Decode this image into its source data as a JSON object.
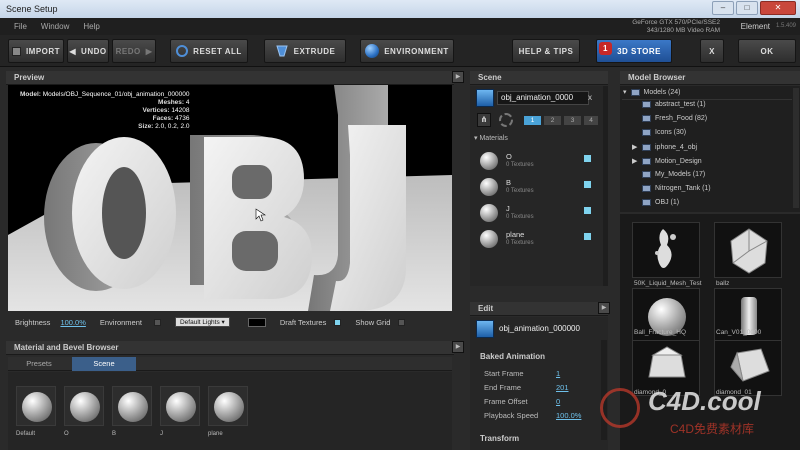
{
  "window": {
    "title": "Scene Setup",
    "minimize": "–",
    "maximize": "□",
    "close": "✕"
  },
  "menu": [
    "File",
    "Window",
    "Help"
  ],
  "sysinfo": {
    "gpu": "GeForce GTX 570/PCIe/SSE2",
    "vram": "343/1280 MB Video RAM",
    "app": "Element",
    "version": "1.5.409"
  },
  "toolbar": {
    "import": "IMPORT",
    "undo": "UNDO",
    "redo": "REDO",
    "reset": "RESET ALL",
    "extrude": "EXTRUDE",
    "environment": "ENVIRONMENT",
    "help": "HELP & TIPS",
    "store": "3D STORE",
    "store_badge": "1",
    "close": "X",
    "ok": "OK"
  },
  "preview": {
    "title": "Preview",
    "info": [
      {
        "label": "Model:",
        "value": "Models/OBJ_Sequence_01/obj_animation_000000"
      },
      {
        "label": "Meshes:",
        "value": "4"
      },
      {
        "label": "Vertices:",
        "value": "14208"
      },
      {
        "label": "Faces:",
        "value": "4736"
      },
      {
        "label": "Size:",
        "value": "2.0, 0.2, 2.0"
      }
    ],
    "brightness_label": "Brightness",
    "brightness_value": "100.0%",
    "environment_label": "Environment",
    "lights_value": "Default Lights",
    "draft_label": "Draft Textures",
    "grid_label": "Show Grid"
  },
  "scene": {
    "title": "Scene",
    "object_name": "obj_animation_0000",
    "close": "x",
    "tabs": [
      "1",
      "2",
      "3",
      "4"
    ],
    "materials_header": "Materials",
    "materials": [
      {
        "name": "O",
        "sub": "0 Textures"
      },
      {
        "name": "B",
        "sub": "0 Textures"
      },
      {
        "name": "J",
        "sub": "0 Textures"
      },
      {
        "name": "plane",
        "sub": "0 Textures"
      }
    ]
  },
  "edit": {
    "title": "Edit",
    "object_name": "obj_animation_000000",
    "section": "Baked Animation",
    "rows": [
      {
        "label": "Start Frame",
        "value": "1"
      },
      {
        "label": "End Frame",
        "value": "201"
      },
      {
        "label": "Frame Offset",
        "value": "0"
      },
      {
        "label": "Playback Speed",
        "value": "100.0%"
      }
    ],
    "section2": "Transform"
  },
  "model_browser": {
    "title": "Model Browser",
    "root": "Models (24)",
    "items": [
      {
        "label": "abstract_test (1)",
        "expander": ""
      },
      {
        "label": "Fresh_Food (82)",
        "expander": ""
      },
      {
        "label": "Icons (30)",
        "expander": ""
      },
      {
        "label": "iphone_4_obj",
        "expander": "▶"
      },
      {
        "label": "Motion_Design",
        "expander": "▶"
      },
      {
        "label": "My_Models (17)",
        "expander": ""
      },
      {
        "label": "Nitrogen_Tank (1)",
        "expander": ""
      },
      {
        "label": "OBJ (1)",
        "expander": ""
      }
    ],
    "thumbs": [
      "50K_Liquid_Mesh_Test",
      "ballz",
      "Ball_Fracture_HQ",
      "Can_V01_0000",
      "diamond_0",
      "diamond_01"
    ]
  },
  "material_browser": {
    "title": "Material and Bevel Browser",
    "tabs": [
      "Presets",
      "Scene"
    ],
    "items": [
      "Default",
      "O",
      "B",
      "J",
      "plane"
    ]
  },
  "watermark": {
    "main": "C4D.cool",
    "sub": "C4D免费素材库"
  }
}
